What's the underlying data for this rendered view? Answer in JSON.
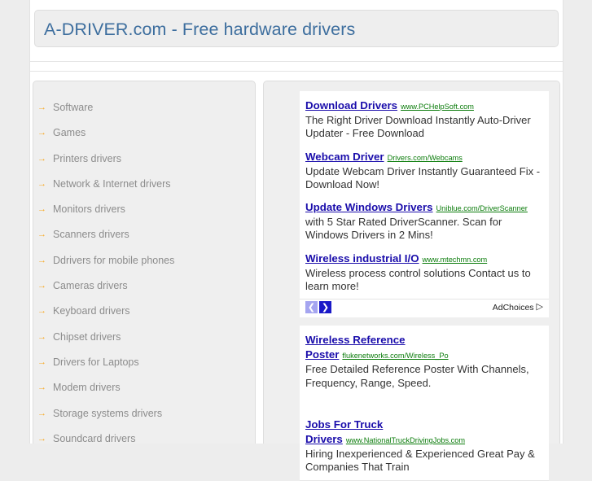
{
  "header": {
    "title": "A-DRIVER.com - Free hardware drivers"
  },
  "sidebar": {
    "bullet": "→",
    "items": [
      {
        "label": "Software"
      },
      {
        "label": "Games"
      },
      {
        "label": "Printers drivers"
      },
      {
        "label": "Network & Internet drivers"
      },
      {
        "label": "Monitors drivers"
      },
      {
        "label": "Scanners drivers"
      },
      {
        "label": "Ddrivers for mobile phones"
      },
      {
        "label": "Cameras drivers"
      },
      {
        "label": "Keyboard drivers"
      },
      {
        "label": "Chipset drivers"
      },
      {
        "label": "Drivers for Laptops"
      },
      {
        "label": "Modem drivers"
      },
      {
        "label": "Storage systems drivers"
      },
      {
        "label": "Soundcard drivers"
      }
    ]
  },
  "ads": {
    "block1": [
      {
        "title": "Download Drivers",
        "url": "www.PCHelpSoft.com",
        "desc": "The Right Driver Download Instantly Auto-Driver Updater - Free Download"
      },
      {
        "title": "Webcam Driver",
        "url": "Drivers.com/Webcams",
        "desc": "Update Webcam Driver Instantly Guaranteed Fix - Download Now!"
      },
      {
        "title": "Update Windows Drivers",
        "url": "Uniblue.com/DriverScanner",
        "desc": "with 5 Star Rated DriverScanner. Scan for Windows Drivers in 2 Mins!"
      },
      {
        "title": "Wireless industrial I/O",
        "url": "www.mtechmn.com",
        "desc": "Wireless process control solutions Contact us to learn more!"
      }
    ],
    "block2": [
      {
        "title": "Wireless Reference Poster",
        "url": "flukenetworks.com/Wireless_Po",
        "desc": "Free Detailed Reference Poster With Channels, Frequency, Range, Speed."
      },
      {
        "title": "Jobs For Truck Drivers",
        "url": "www.NationalTruckDrivingJobs.com",
        "desc": "Hiring Inexperienced & Experienced Great Pay & Companies That Train"
      }
    ],
    "nav": {
      "prev": "❮",
      "next": "❯"
    },
    "adchoices": {
      "label": "AdChoices",
      "glyph": "▷"
    }
  },
  "colors": {
    "title": "#3d6e9e",
    "ad_title": "#1a0dab",
    "ad_url": "#0b7c0b",
    "bullet": "#f7a823",
    "panel": "#efefef",
    "page_bg": "#ededed"
  }
}
